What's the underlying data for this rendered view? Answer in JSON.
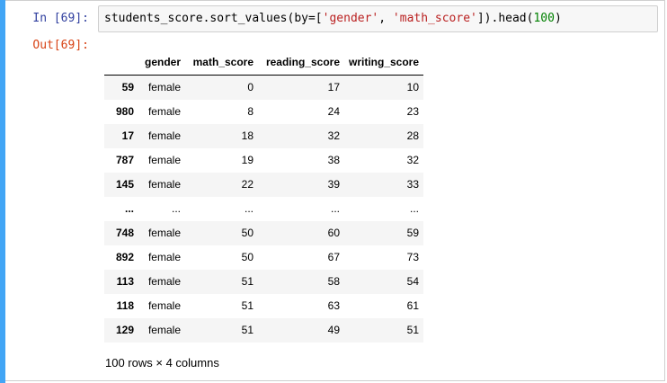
{
  "cell": {
    "in_prompt": "In [69]:",
    "out_prompt": "Out[69]:",
    "code": {
      "part1": "students_score.sort_values(by=[",
      "str1": "'gender'",
      "part2": ", ",
      "str2": "'math_score'",
      "part3": "]).head(",
      "num": "100",
      "part4": ")"
    }
  },
  "table": {
    "columns": [
      "gender",
      "math_score",
      "reading_score",
      "writing_score"
    ],
    "rows": [
      {
        "index": "59",
        "gender": "female",
        "math_score": "0",
        "reading_score": "17",
        "writing_score": "10"
      },
      {
        "index": "980",
        "gender": "female",
        "math_score": "8",
        "reading_score": "24",
        "writing_score": "23"
      },
      {
        "index": "17",
        "gender": "female",
        "math_score": "18",
        "reading_score": "32",
        "writing_score": "28"
      },
      {
        "index": "787",
        "gender": "female",
        "math_score": "19",
        "reading_score": "38",
        "writing_score": "32"
      },
      {
        "index": "145",
        "gender": "female",
        "math_score": "22",
        "reading_score": "39",
        "writing_score": "33"
      },
      {
        "index": "...",
        "gender": "...",
        "math_score": "...",
        "reading_score": "...",
        "writing_score": "..."
      },
      {
        "index": "748",
        "gender": "female",
        "math_score": "50",
        "reading_score": "60",
        "writing_score": "59"
      },
      {
        "index": "892",
        "gender": "female",
        "math_score": "50",
        "reading_score": "67",
        "writing_score": "73"
      },
      {
        "index": "113",
        "gender": "female",
        "math_score": "51",
        "reading_score": "58",
        "writing_score": "54"
      },
      {
        "index": "118",
        "gender": "female",
        "math_score": "51",
        "reading_score": "63",
        "writing_score": "61"
      },
      {
        "index": "129",
        "gender": "female",
        "math_score": "51",
        "reading_score": "49",
        "writing_score": "51"
      }
    ]
  },
  "footer": "100 rows × 4 columns",
  "colors": {
    "cell_bar": "#42a5f5",
    "in_prompt": "#303f9f",
    "out_prompt": "#d84315",
    "string": "#ba2121",
    "number": "#008000",
    "zebra": "#f5f5f5"
  }
}
